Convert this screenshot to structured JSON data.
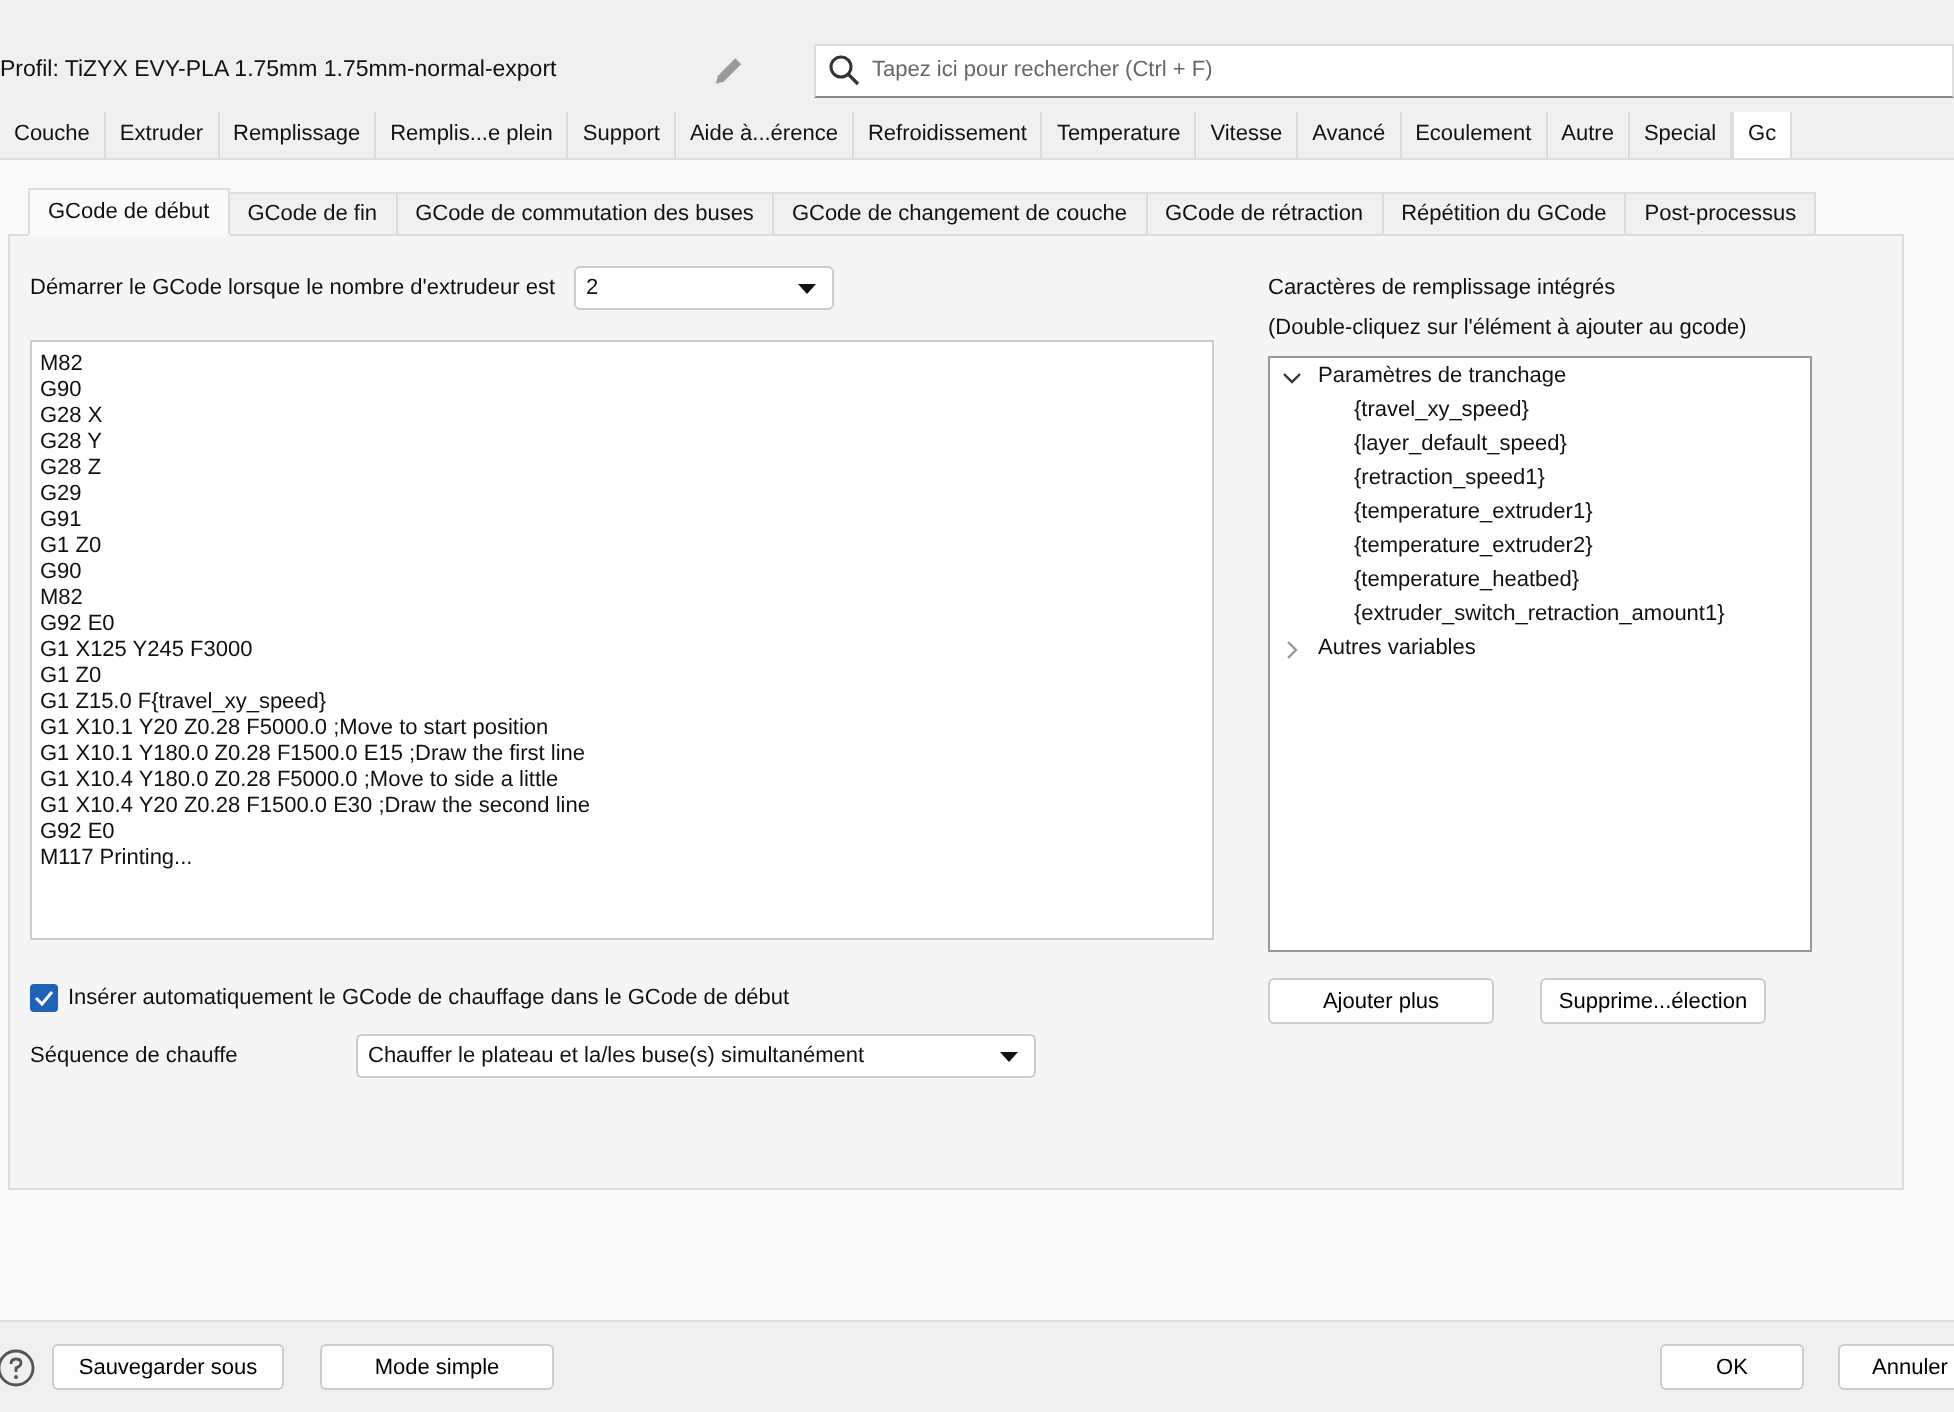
{
  "profile": {
    "label": "Profil: TiZYX EVY-PLA 1.75mm 1.75mm-normal-export"
  },
  "search": {
    "placeholder": "Tapez ici pour rechercher (Ctrl + F)"
  },
  "tabs": [
    {
      "label": "Couche",
      "selected": false
    },
    {
      "label": "Extruder",
      "selected": false
    },
    {
      "label": "Remplissage",
      "selected": false
    },
    {
      "label": "Remplis...e plein",
      "selected": false
    },
    {
      "label": "Support",
      "selected": false
    },
    {
      "label": "Aide à...érence",
      "selected": false
    },
    {
      "label": "Refroidissement",
      "selected": false
    },
    {
      "label": "Temperature",
      "selected": false
    },
    {
      "label": "Vitesse",
      "selected": false
    },
    {
      "label": "Avancé",
      "selected": false
    },
    {
      "label": "Ecoulement",
      "selected": false
    },
    {
      "label": "Autre",
      "selected": false
    },
    {
      "label": "Special",
      "selected": false
    },
    {
      "label": "Gc",
      "selected": true
    }
  ],
  "subtabs": [
    {
      "label": "GCode de début",
      "selected": true
    },
    {
      "label": "GCode de fin",
      "selected": false
    },
    {
      "label": "GCode de commutation des buses",
      "selected": false
    },
    {
      "label": "GCode de changement de couche",
      "selected": false
    },
    {
      "label": "GCode de rétraction",
      "selected": false
    },
    {
      "label": "Répétition du GCode",
      "selected": false
    },
    {
      "label": "Post-processus",
      "selected": false
    }
  ],
  "extruder_select": {
    "label": "Démarrer le GCode lorsque le nombre d'extrudeur est",
    "value": "2"
  },
  "gcode_lines": [
    "M82",
    "G90",
    "G28 X",
    "G28 Y",
    "G28 Z",
    "G29",
    "G91",
    "G1 Z0",
    "G90",
    "M82",
    "G92 E0",
    "G1 X125 Y245 F3000",
    "G1 Z0",
    "G1 Z15.0 F{travel_xy_speed}",
    "G1 X10.1 Y20 Z0.28 F5000.0 ;Move to start position",
    "G1 X10.1 Y180.0 Z0.28 F1500.0 E15 ;Draw the first line",
    "G1 X10.4 Y180.0 Z0.28 F5000.0 ;Move to side a little",
    "G1 X10.4 Y20 Z0.28 F1500.0 E30 ;Draw the second line",
    "G92 E0",
    "M117 Printing..."
  ],
  "placeholders_panel": {
    "title": "Caractères de remplissage intégrés",
    "hint": "(Double-cliquez sur l'élément à ajouter au gcode)",
    "tree": [
      {
        "label": "Paramètres de tranchage",
        "expanded": true,
        "children": [
          {
            "label": "{travel_xy_speed}"
          },
          {
            "label": "{layer_default_speed}"
          },
          {
            "label": "{retraction_speed1}"
          },
          {
            "label": "{temperature_extruder1}"
          },
          {
            "label": "{temperature_extruder2}"
          },
          {
            "label": "{temperature_heatbed}"
          },
          {
            "label": "{extruder_switch_retraction_amount1}"
          }
        ]
      },
      {
        "label": "Autres variables",
        "expanded": false
      }
    ],
    "buttons": [
      "Ajouter plus",
      "Supprime...élection"
    ]
  },
  "auto_heat": {
    "label": "Insérer automatiquement le GCode de chauffage dans le GCode de début",
    "checked": true
  },
  "heat_sequence": {
    "label": "Séquence de chauffe",
    "value": "Chauffer le plateau et la/les buse(s) simultanément"
  },
  "footer": {
    "left_buttons": [
      "Sauvegarder sous",
      "Mode simple"
    ],
    "right_buttons": [
      "OK",
      "Annuler"
    ]
  }
}
